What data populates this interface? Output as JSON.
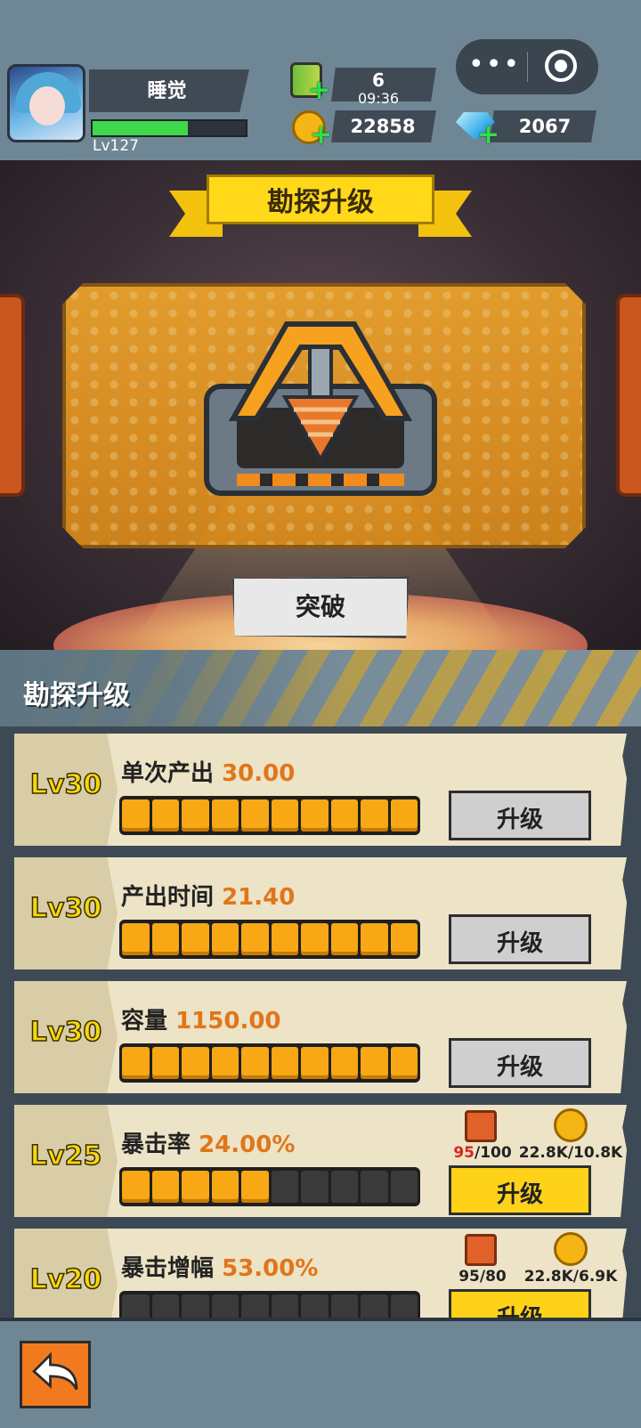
{
  "player": {
    "name": "睡觉",
    "level": "Lv127",
    "xp_fraction": 0.62
  },
  "resources": {
    "energy": {
      "count": "6",
      "timer": "09:36",
      "icon": "energy-can-icon"
    },
    "gold": {
      "amount": "22858",
      "icon": "gold-coin-icon"
    },
    "diamond": {
      "amount": "2067",
      "icon": "diamond-icon"
    }
  },
  "capsule": {
    "more_icon": "more-icon",
    "close_icon": "close-icon"
  },
  "scene": {
    "title": "勘探升级",
    "action_label": "突破"
  },
  "section": {
    "title": "勘探升级"
  },
  "upgrades": [
    {
      "level": "Lv30",
      "stat": "单次产出",
      "value": "30.00",
      "filled": 10,
      "total": 10,
      "button": "升级",
      "enabled": false
    },
    {
      "level": "Lv30",
      "stat": "产出时间",
      "value": "21.40",
      "filled": 10,
      "total": 10,
      "button": "升级",
      "enabled": false
    },
    {
      "level": "Lv30",
      "stat": "容量",
      "value": "1150.00",
      "filled": 10,
      "total": 10,
      "button": "升级",
      "enabled": false
    },
    {
      "level": "Lv25",
      "stat": "暴击率",
      "value": "24.00%",
      "filled": 5,
      "total": 10,
      "button": "升级",
      "enabled": true,
      "cost_material": {
        "have": "95",
        "need": "/100",
        "insufficient": true
      },
      "cost_gold": "22.8K/10.8K"
    },
    {
      "level": "Lv20",
      "stat": "暴击增幅",
      "value": "53.00%",
      "filled": 0,
      "total": 10,
      "button": "升级",
      "enabled": true,
      "cost_material": {
        "have": "95",
        "need": "/80",
        "insufficient": false
      },
      "cost_gold": "22.8K/6.9K"
    }
  ],
  "colors": {
    "accent": "#ffd21a",
    "value": "#e0761a",
    "bar_fill": "#f7a814",
    "xp": "#3fd84a"
  }
}
